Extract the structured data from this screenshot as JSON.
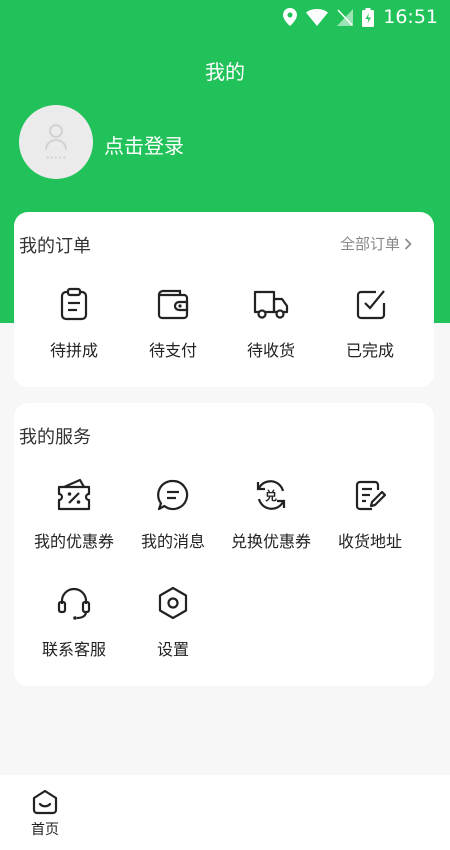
{
  "status_bar": {
    "time": "16:51"
  },
  "header": {
    "title": "我的"
  },
  "profile": {
    "login_label": "点击登录"
  },
  "orders": {
    "title": "我的订单",
    "all_label": "全部订单",
    "items": [
      {
        "label": "待拼成",
        "icon": "clipboard-icon"
      },
      {
        "label": "待支付",
        "icon": "wallet-icon"
      },
      {
        "label": "待收货",
        "icon": "truck-icon"
      },
      {
        "label": "已完成",
        "icon": "checkbox-icon"
      }
    ]
  },
  "services": {
    "title": "我的服务",
    "items": [
      {
        "label": "我的优惠券",
        "icon": "coupon-icon"
      },
      {
        "label": "我的消息",
        "icon": "message-icon"
      },
      {
        "label": "兑换优惠券",
        "icon": "exchange-icon"
      },
      {
        "label": "收货地址",
        "icon": "address-icon"
      },
      {
        "label": "联系客服",
        "icon": "headset-icon"
      },
      {
        "label": "设置",
        "icon": "settings-icon"
      }
    ]
  },
  "tabbar": {
    "home_label": "首页"
  },
  "colors": {
    "brand": "#22c25a",
    "background": "#f7f7f7",
    "card": "#ffffff"
  }
}
